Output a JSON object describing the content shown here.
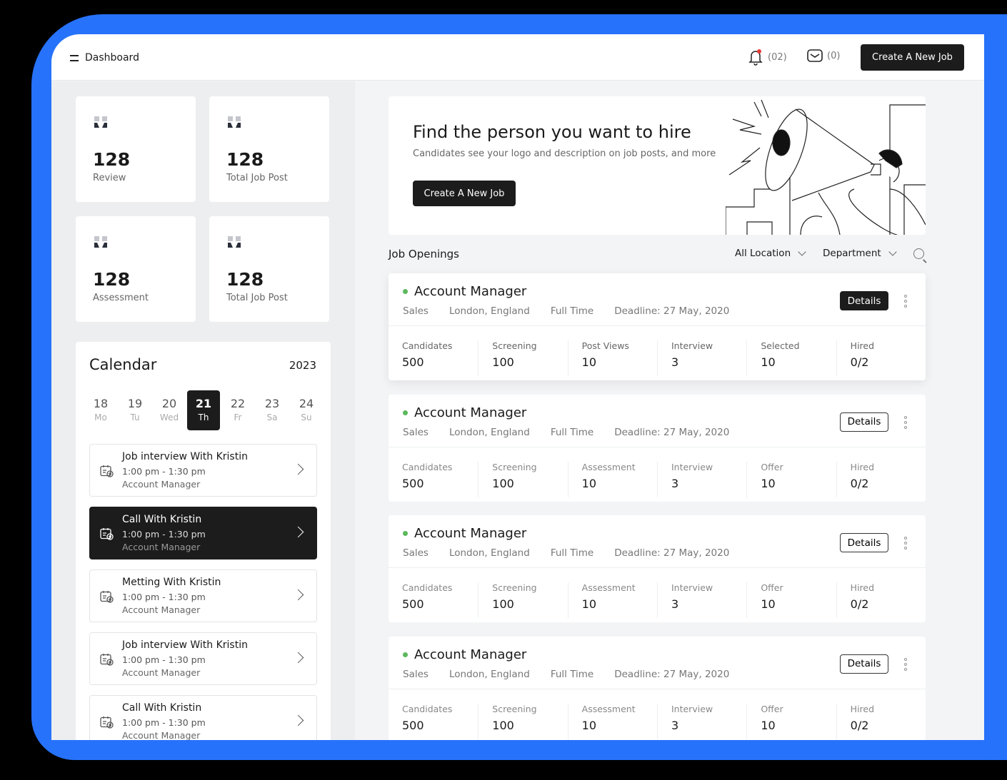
{
  "header": {
    "title": "Dashboard",
    "notifications_count": "(02)",
    "messages_count": "(0)",
    "create_button": "Create A New Job",
    "accent": "#2772fb"
  },
  "stats": [
    {
      "value": "128",
      "label": "Review"
    },
    {
      "value": "128",
      "label": "Total Job Post"
    },
    {
      "value": "128",
      "label": "Assessment"
    },
    {
      "value": "128",
      "label": "Total Job Post"
    }
  ],
  "calendar": {
    "title": "Calendar",
    "year": "2023",
    "days": [
      {
        "d": "18",
        "w": "Mo"
      },
      {
        "d": "19",
        "w": "Tu"
      },
      {
        "d": "20",
        "w": "Wed"
      },
      {
        "d": "21",
        "w": "Th",
        "selected": true
      },
      {
        "d": "22",
        "w": "Fr"
      },
      {
        "d": "23",
        "w": "Sa"
      },
      {
        "d": "24",
        "w": "Su"
      }
    ],
    "events": [
      {
        "title": "Job interview With Kristin",
        "time": "1:00 pm - 1:30 pm",
        "role": "Account Manager"
      },
      {
        "title": "Call With Kristin",
        "time": "1:00 pm - 1:30 pm",
        "role": "Account Manager",
        "active": true
      },
      {
        "title": "Metting With Kristin",
        "time": "1:00 pm - 1:30 pm",
        "role": "Account Manager"
      },
      {
        "title": "Job interview With Kristin",
        "time": "1:00 pm - 1:30 pm",
        "role": "Account Manager"
      },
      {
        "title": "Call With Kristin",
        "time": "1:00 pm - 1:30 pm",
        "role": "Account Manager"
      }
    ]
  },
  "hero": {
    "title": "Find the person you want to hire",
    "subtitle": "Candidates see your logo and description on job posts, and more",
    "button": "Create A New Job"
  },
  "job_openings": {
    "title": "Job Openings",
    "filter_location": "All Location",
    "filter_department": "Department",
    "jobs": [
      {
        "title": "Account Manager",
        "department": "Sales",
        "location": "London, England",
        "type": "Full Time",
        "deadline": "Deadline: 27 May, 2020",
        "details": "Details",
        "status_color": "#5cb85c",
        "stats": [
          {
            "label": "Candidates",
            "value": "500"
          },
          {
            "label": "Screening",
            "value": "100"
          },
          {
            "label": "Post Views",
            "value": "10"
          },
          {
            "label": "Interview",
            "value": "3"
          },
          {
            "label": "Selected",
            "value": "10"
          },
          {
            "label": "Hired",
            "value": "0/2"
          }
        ]
      },
      {
        "title": "Account Manager",
        "department": "Sales",
        "location": "London, England",
        "type": "Full Time",
        "deadline": "Deadline: 27 May, 2020",
        "details": "Details",
        "status_color": "#5cb85c",
        "stats": [
          {
            "label": "Candidates",
            "value": "500"
          },
          {
            "label": "Screening",
            "value": "100"
          },
          {
            "label": "Assessment",
            "value": "10"
          },
          {
            "label": "Interview",
            "value": "3"
          },
          {
            "label": "Offer",
            "value": "10"
          },
          {
            "label": "Hired",
            "value": "0/2"
          }
        ]
      },
      {
        "title": "Account Manager",
        "department": "Sales",
        "location": "London, England",
        "type": "Full Time",
        "deadline": "Deadline: 27 May, 2020",
        "details": "Details",
        "status_color": "#5cb85c",
        "stats": [
          {
            "label": "Candidates",
            "value": "500"
          },
          {
            "label": "Screening",
            "value": "100"
          },
          {
            "label": "Assessment",
            "value": "10"
          },
          {
            "label": "Interview",
            "value": "3"
          },
          {
            "label": "Offer",
            "value": "10"
          },
          {
            "label": "Hired",
            "value": "0/2"
          }
        ]
      },
      {
        "title": "Account Manager",
        "department": "Sales",
        "location": "London, England",
        "type": "Full Time",
        "deadline": "Deadline: 27 May, 2020",
        "details": "Details",
        "status_color": "#5cb85c",
        "stats": [
          {
            "label": "Candidates",
            "value": "500"
          },
          {
            "label": "Screening",
            "value": "100"
          },
          {
            "label": "Assessment",
            "value": "10"
          },
          {
            "label": "Interview",
            "value": "3"
          },
          {
            "label": "Offer",
            "value": "10"
          },
          {
            "label": "Hired",
            "value": "0/2"
          }
        ]
      }
    ]
  }
}
